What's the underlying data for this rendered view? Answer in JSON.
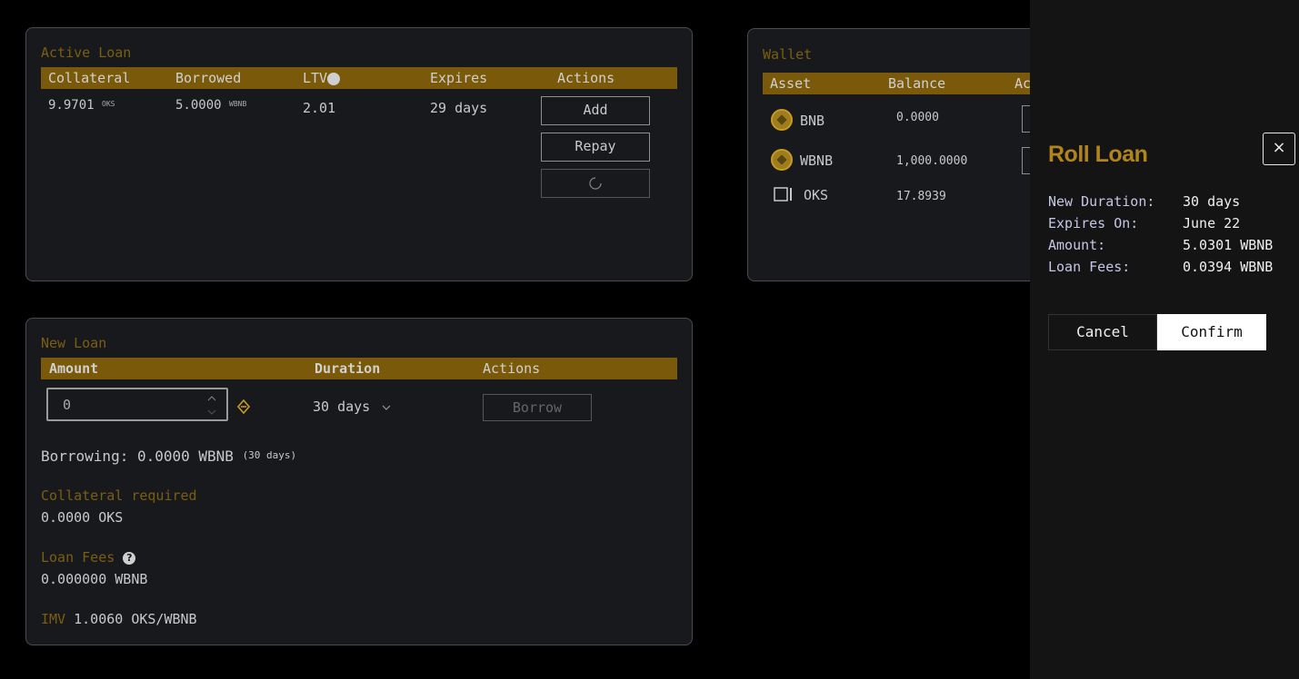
{
  "active_loan": {
    "title": "Active Loan",
    "headers": {
      "collateral": "Collateral",
      "borrowed": "Borrowed",
      "ltv": "LTV",
      "expires": "Expires",
      "actions": "Actions"
    },
    "row": {
      "collateral_value": "9.9701",
      "collateral_unit": "OKS",
      "borrowed_value": "5.0000",
      "borrowed_unit": "WBNB",
      "ltv": "2.01",
      "expires": "29 days"
    },
    "buttons": {
      "add": "Add",
      "repay": "Repay"
    }
  },
  "wallet": {
    "title": "Wallet",
    "headers": {
      "asset": "Asset",
      "balance": "Balance",
      "actions": "Ac"
    },
    "rows": [
      {
        "asset": "BNB",
        "balance": "0.0000",
        "icon": "bnb-coin-icon"
      },
      {
        "asset": "WBNB",
        "balance": "1,000.0000",
        "icon": "bnb-coin-icon"
      },
      {
        "asset": "OKS",
        "balance": "17.8939",
        "icon": "wallet-icon"
      }
    ]
  },
  "new_loan": {
    "title": "New Loan",
    "headers": {
      "amount": "Amount",
      "duration": "Duration",
      "actions": "Actions"
    },
    "amount_value": "0",
    "duration": "30 days",
    "borrow_button": "Borrow",
    "borrowing_label": "Borrowing: 0.0000 WBNB",
    "borrowing_note": "(30 days)",
    "collateral_label": "Collateral required",
    "collateral_value": "0.0000 OKS",
    "fees_label": "Loan Fees",
    "fees_value": "0.000000 WBNB",
    "imv_label": "IMV",
    "imv_value": "1.0060 OKS/WBNB"
  },
  "roll_loan": {
    "title": "Roll Loan",
    "close": "×",
    "rows": [
      {
        "label": "New Duration:",
        "value": "30 days"
      },
      {
        "label": "Expires On:",
        "value": "June 22"
      },
      {
        "label": "Amount:",
        "value": "5.0301 WBNB"
      },
      {
        "label": "Loan Fees:",
        "value": "0.0394 WBNB"
      }
    ],
    "cancel": "Cancel",
    "confirm": "Confirm"
  },
  "colors": {
    "accent": "#7a5a0a",
    "title_gold": "#7c5e10",
    "drawer_bg": "#141414",
    "panel_bg": "#17191d"
  }
}
